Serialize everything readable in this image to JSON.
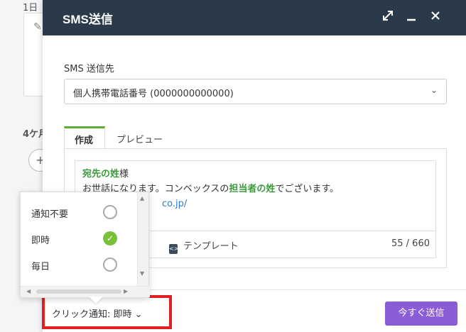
{
  "background": {
    "text1": "1日",
    "text2": "4ケ月",
    "circle_icon": "+"
  },
  "modal": {
    "title": "SMS送信",
    "to_label": "SMS 送信先",
    "to_value": "個人携帯電話番号 (0000000000000)",
    "tabs": [
      {
        "label": "作成",
        "active": true
      },
      {
        "label": "プレビュー",
        "active": false
      }
    ],
    "message": {
      "line1_var": "宛先の姓",
      "line1_text": "様",
      "line2_pre": "お世話になります。コンベックスの",
      "line2_var": "担当者の姓",
      "line2_post": "でございます。",
      "line3_link": "co.jp/"
    },
    "toolbar": {
      "item1": "目",
      "template": "テンプレート",
      "count": "55 / 660"
    },
    "send_button": "今すぐ送信",
    "notify_trigger": "クリック通知: 即時 ⌄"
  },
  "notify_options": [
    {
      "label": "通知不要",
      "selected": false
    },
    {
      "label": "即時",
      "selected": true
    },
    {
      "label": "毎日",
      "selected": false
    }
  ],
  "colors": {
    "header": "#2b3a4a",
    "accent_green": "#5ab032",
    "send_button": "#8a5cd6",
    "highlight": "#e02020"
  }
}
